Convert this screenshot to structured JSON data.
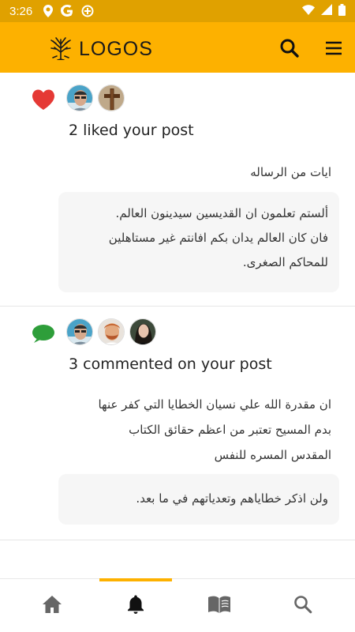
{
  "status_bar": {
    "time": "3:26",
    "icons": [
      "location-icon",
      "google-icon",
      "data-saver-icon",
      "wifi-icon",
      "signal-icon",
      "battery-icon"
    ]
  },
  "app_bar": {
    "logo_text": "LOGOS",
    "logo_icon": "tree-icon",
    "search_icon": "search-icon",
    "menu_icon": "menu-icon",
    "background": "#fdb100"
  },
  "notifications": [
    {
      "type": "like",
      "type_icon": "heart-icon",
      "type_color": "#e53935",
      "avatars": [
        "avatar-man-glasses",
        "avatar-cross"
      ],
      "headline": "2 liked your post",
      "post_text": "ايات من الرساله",
      "quote_lines": [
        "ألستم تعلمون ان القديسين سيدينون العالم.",
        "فان كان العالم يدان بكم افانتم غير مستاهلين",
        "للمحاكم الصغرى."
      ]
    },
    {
      "type": "comment",
      "type_icon": "comment-bubble-icon",
      "type_color": "#2e9e3a",
      "avatars": [
        "avatar-man-glasses",
        "avatar-man-beard",
        "avatar-woman"
      ],
      "headline": "3 commented on your post",
      "post_lines": [
        "ان مقدرة الله علي نسيان الخطايا التي كفر عنها",
        "بدم المسيح تعتبر من اعظم حقائق الكتاب",
        "المقدس المسره للنفس"
      ],
      "quote_lines": [
        "ولن اذكر خطاياهم وتعدياتهم في ما بعد."
      ]
    }
  ],
  "bottom_nav": {
    "items": [
      "home-icon",
      "notifications-icon",
      "book-icon",
      "search-icon"
    ],
    "active_index": 1,
    "accent": "#fdb100"
  }
}
